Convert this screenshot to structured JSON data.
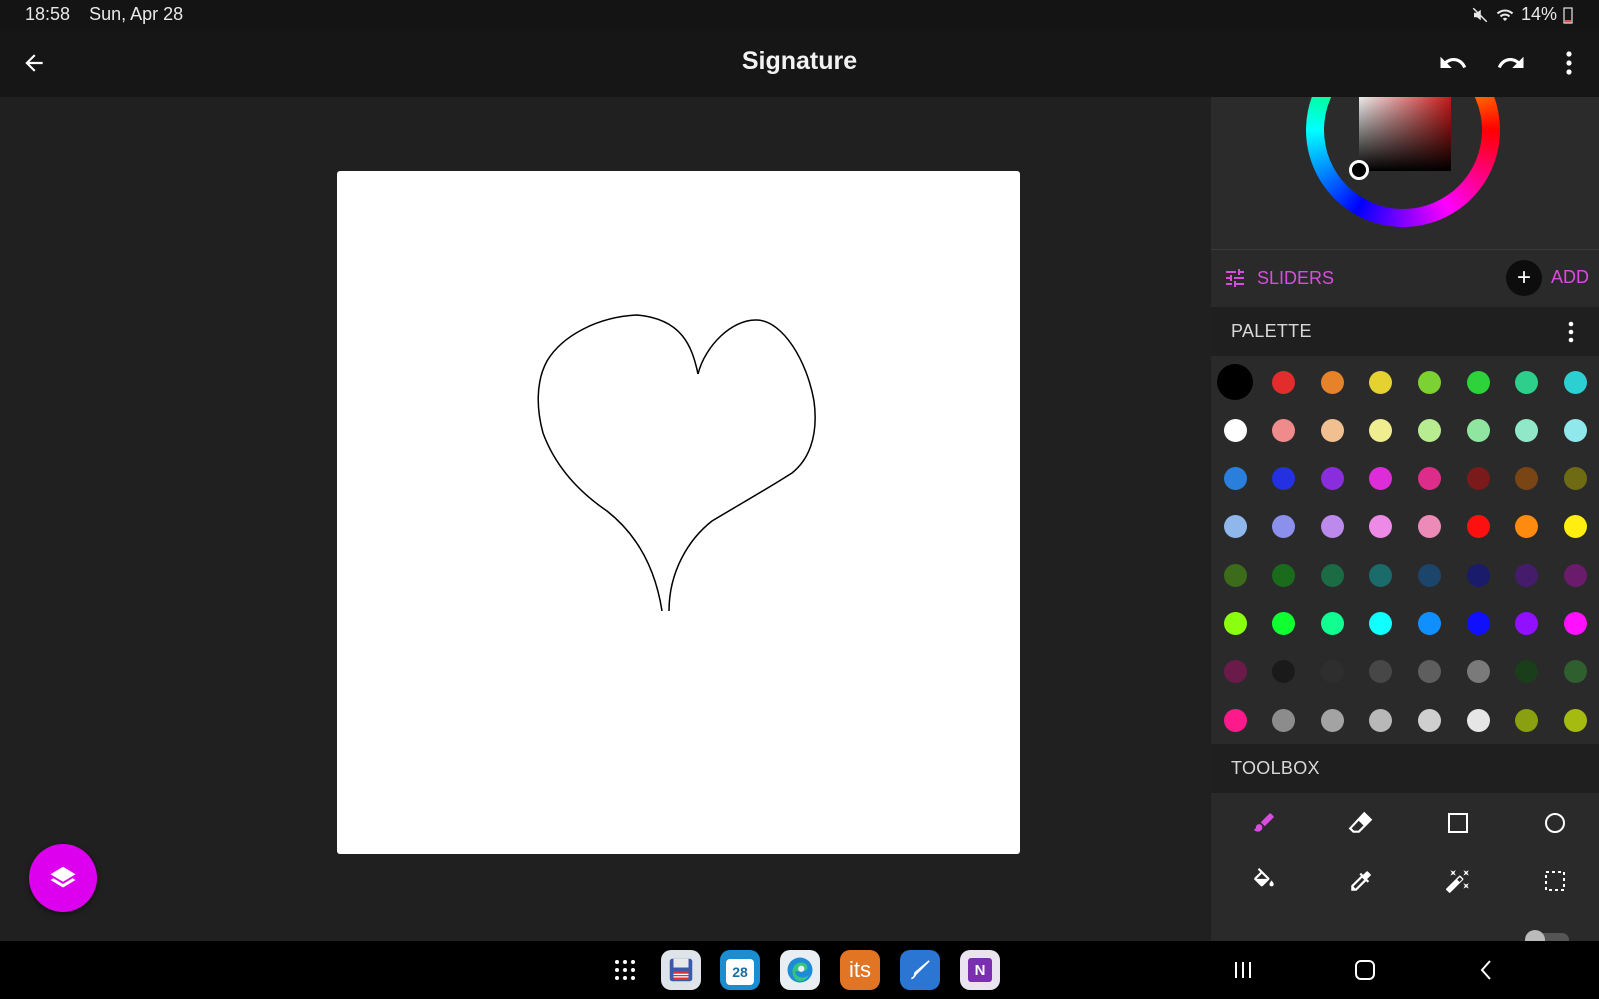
{
  "status_bar": {
    "time": "18:58",
    "date": "Sun, Apr 28",
    "battery": "14%"
  },
  "app_bar": {
    "title": "Signature"
  },
  "color_picker": {
    "selected_color": "#000000"
  },
  "sliders": {
    "label": "SLIDERS",
    "add_label": "ADD"
  },
  "palette": {
    "header": "PALETTE",
    "colors": [
      [
        "#000000",
        "#e32d2d",
        "#e5822a",
        "#e5d12f",
        "#7cd233",
        "#2ed23a",
        "#2dcf8a",
        "#2dd0d2"
      ],
      [
        "#ffffff",
        "#f08b8b",
        "#f0c090",
        "#f0ec90",
        "#b8ec90",
        "#90e6a0",
        "#90e8c8",
        "#90e8ec"
      ],
      [
        "#2b7fdc",
        "#2431e0",
        "#8a2ddc",
        "#dd2dd8",
        "#dd2d8a",
        "#7a1a1a",
        "#7a4514",
        "#6f6a14"
      ],
      [
        "#8fb7ec",
        "#8a90ec",
        "#bb8aec",
        "#ec8ae6",
        "#ec8ab8",
        "#ff1010",
        "#ff8a10",
        "#ffee10"
      ],
      [
        "#3d6b1c",
        "#1b6b1c",
        "#1b6b45",
        "#1b6b6b",
        "#1b456b",
        "#1b1b6b",
        "#451b6b",
        "#6b1b6b"
      ],
      [
        "#8aff10",
        "#10ff30",
        "#10ff90",
        "#10ffff",
        "#1090ff",
        "#1010ff",
        "#9010ff",
        "#ff10ff"
      ],
      [
        "#6b1b4a",
        "#1a1a1a",
        "#2e2e2e",
        "#474747",
        "#5e5e5e",
        "#7a7a7a",
        "#1a3d1a",
        "#2f5f2f"
      ],
      [
        "#ff1a8c",
        "#8c8c8c",
        "#a3a3a3",
        "#b8b8b8",
        "#cfcfcf",
        "#e6e6e6",
        "#8aa010",
        "#a6bb10"
      ]
    ]
  },
  "toolbox": {
    "header": "TOOLBOX",
    "tools": [
      {
        "name": "brush-icon",
        "active": true
      },
      {
        "name": "eraser-icon",
        "active": false
      },
      {
        "name": "rectangle-icon",
        "active": false
      },
      {
        "name": "circle-icon",
        "active": false
      },
      {
        "name": "fill-bucket-icon",
        "active": false
      },
      {
        "name": "eyedropper-icon",
        "active": false
      },
      {
        "name": "magic-wand-icon",
        "active": false
      },
      {
        "name": "selection-icon",
        "active": false
      }
    ]
  },
  "accent_color": "#dd00ee",
  "dock": [
    "app-drawer-icon",
    "save-app-icon",
    "calendar-app-icon",
    "edge-browser-icon",
    "its-app-icon",
    "pen-app-icon",
    "onenote-app-icon"
  ],
  "dock_labels": {
    "calendar": "28",
    "its": "its",
    "onenote": "N"
  }
}
